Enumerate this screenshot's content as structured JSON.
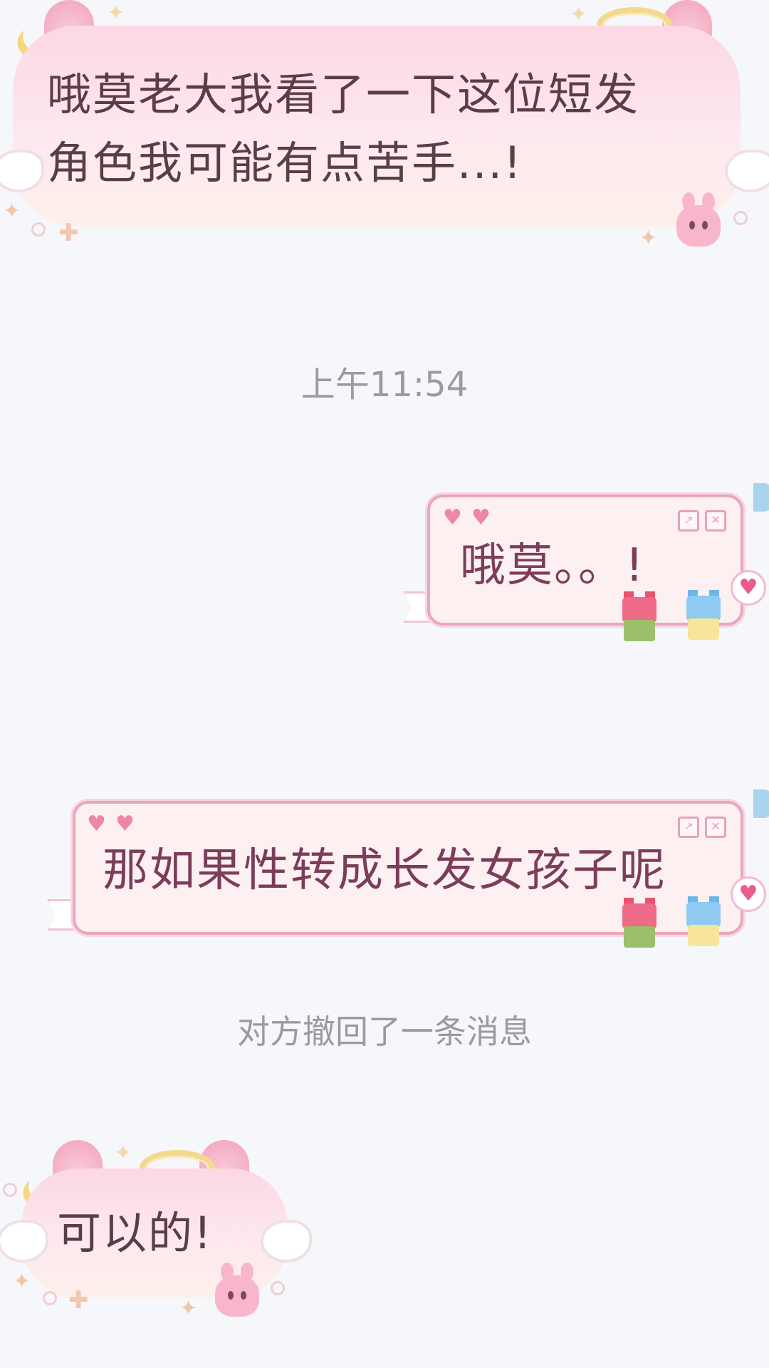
{
  "messages": [
    {
      "id": "m1",
      "direction": "incoming",
      "text_line1": "哦莫老大我看了一下这位短发",
      "text_line2": "角色我可能有点苦手...!"
    },
    {
      "id": "m2",
      "direction": "outgoing",
      "text": "哦莫。。!"
    },
    {
      "id": "m3",
      "direction": "outgoing",
      "text": "那如果性转成长发女孩子呢"
    },
    {
      "id": "m4",
      "direction": "incoming",
      "text": "可以的!"
    }
  ],
  "system": {
    "timestamp": "上午11:54",
    "recall_notice": "对方撤回了一条消息"
  },
  "icons": {
    "window_buttons": [
      "expand-icon",
      "close-icon"
    ],
    "heart": "heart-icon"
  },
  "glyphs": {
    "heart": "♥",
    "sparkle": "✦",
    "plus": "✚",
    "expand": "↗",
    "close": "✕"
  },
  "colors": {
    "background": "#f6f7fa",
    "incoming_bubble": "#fde2ea",
    "outgoing_bubble": "#fdf0f1",
    "outgoing_border": "#e8a6bf",
    "incoming_text": "#5a3d47",
    "outgoing_text": "#7c3d5b",
    "system_text": "#9b9b9f"
  }
}
